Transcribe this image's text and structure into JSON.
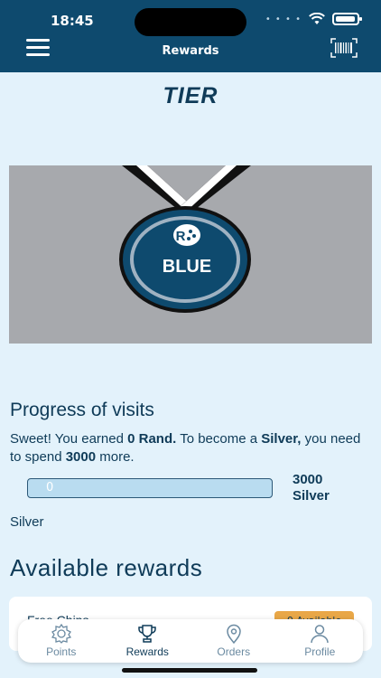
{
  "status": {
    "time": "18:45"
  },
  "header": {
    "title": "Rewards"
  },
  "tier": {
    "title": "TIER",
    "medal_label": "BLUE",
    "colors": {
      "medal": "#0e4a6e",
      "ribbon": "#ffffff",
      "background": "#a7a9ad"
    }
  },
  "progress": {
    "title": "Progress of visits",
    "desc_prefix": "Sweet! You earned ",
    "earned": "0 Rand.",
    "desc_middle": " To become a ",
    "next_tier": "Silver,",
    "desc_suffix": " you need to spend ",
    "amount_needed": "3000",
    "desc_end": " more.",
    "current_value": "0",
    "fraction": 0,
    "target_points": "3000",
    "target_tier": "Silver",
    "next_tier_label": "Silver"
  },
  "rewards": {
    "title": "Available rewards",
    "items": [
      {
        "name": "Free Chips",
        "badge": "0 Available"
      }
    ]
  },
  "tabs": [
    {
      "label": "Points",
      "icon": "gear-badge-icon",
      "active": false
    },
    {
      "label": "Rewards",
      "icon": "trophy-icon",
      "active": true
    },
    {
      "label": "Orders",
      "icon": "location-pin-icon",
      "active": false
    },
    {
      "label": "Profile",
      "icon": "person-icon",
      "active": false
    }
  ]
}
